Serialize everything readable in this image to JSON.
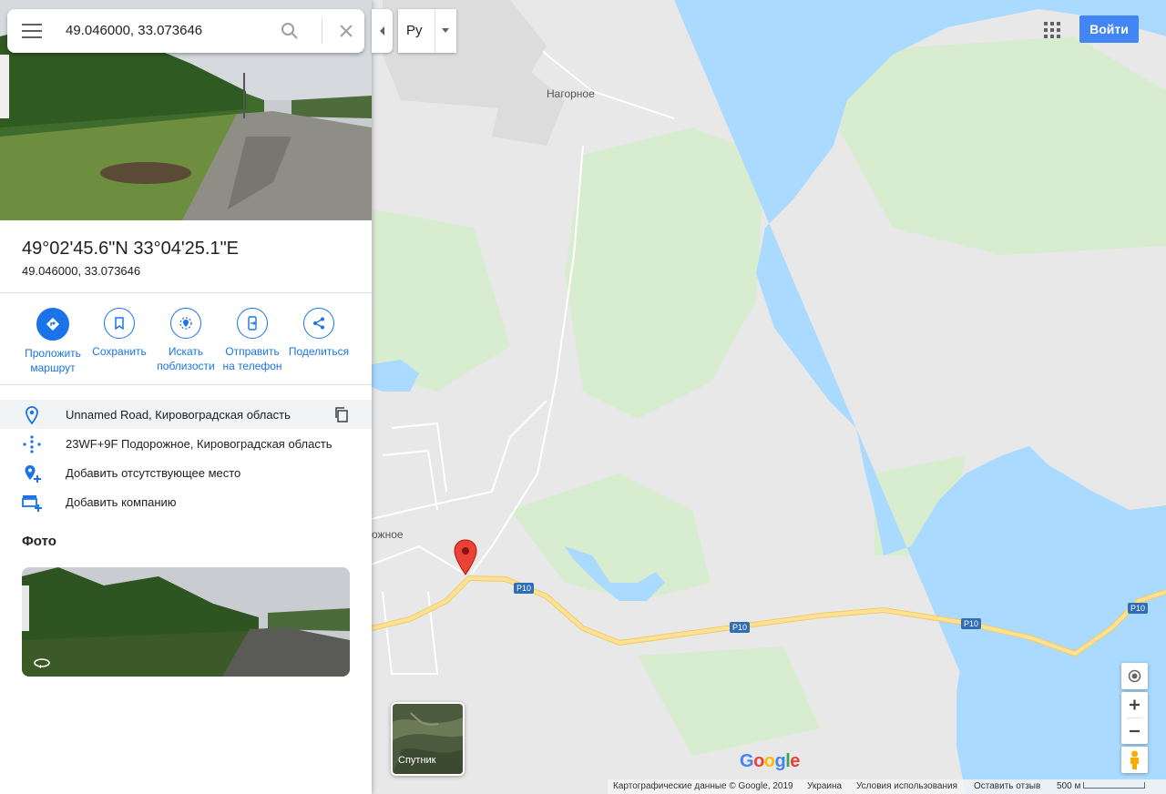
{
  "search": {
    "query": "49.046000, 33.073646"
  },
  "place": {
    "title": "49°02'45.6\"N 33°04'25.1\"E",
    "subtitle": "49.046000, 33.073646"
  },
  "actions": [
    {
      "label": "Проложить маршрут",
      "icon": "directions-icon"
    },
    {
      "label": "Сохранить",
      "icon": "bookmark-icon"
    },
    {
      "label": "Искать поблизости",
      "icon": "nearby-icon"
    },
    {
      "label": "Отправить на телефон",
      "icon": "send-to-phone-icon"
    },
    {
      "label": "Поделиться",
      "icon": "share-icon"
    }
  ],
  "info_rows": [
    {
      "text": "Unnamed Road, Кировоградская область",
      "icon": "location-pin-icon"
    },
    {
      "text": "23WF+9F Подорожное, Кировоградская область",
      "icon": "plus-code-icon"
    },
    {
      "text": "Добавить отсутствующее место",
      "icon": "add-place-icon"
    },
    {
      "text": "Добавить компанию",
      "icon": "add-business-icon"
    }
  ],
  "photos": {
    "heading": "Фото"
  },
  "language": {
    "label": "Ру"
  },
  "account": {
    "signin_label": "Войти"
  },
  "map": {
    "places": {
      "nagornoe": "Нагорное",
      "podorozhnoe": "ожное"
    },
    "road_labels": {
      "r10": "Р10"
    },
    "satellite_label": "Спутник",
    "logo": "Google"
  },
  "footer": {
    "map_data": "Картографические данные © Google, 2019",
    "country": "Украина",
    "terms": "Условия использования",
    "feedback": "Оставить отзыв",
    "scale": "500 м"
  },
  "colors": {
    "accent": "#1a73e8",
    "water": "#aadaff",
    "land": "#e8e8e8",
    "road": "#fde293",
    "signin": "#4285f4"
  }
}
